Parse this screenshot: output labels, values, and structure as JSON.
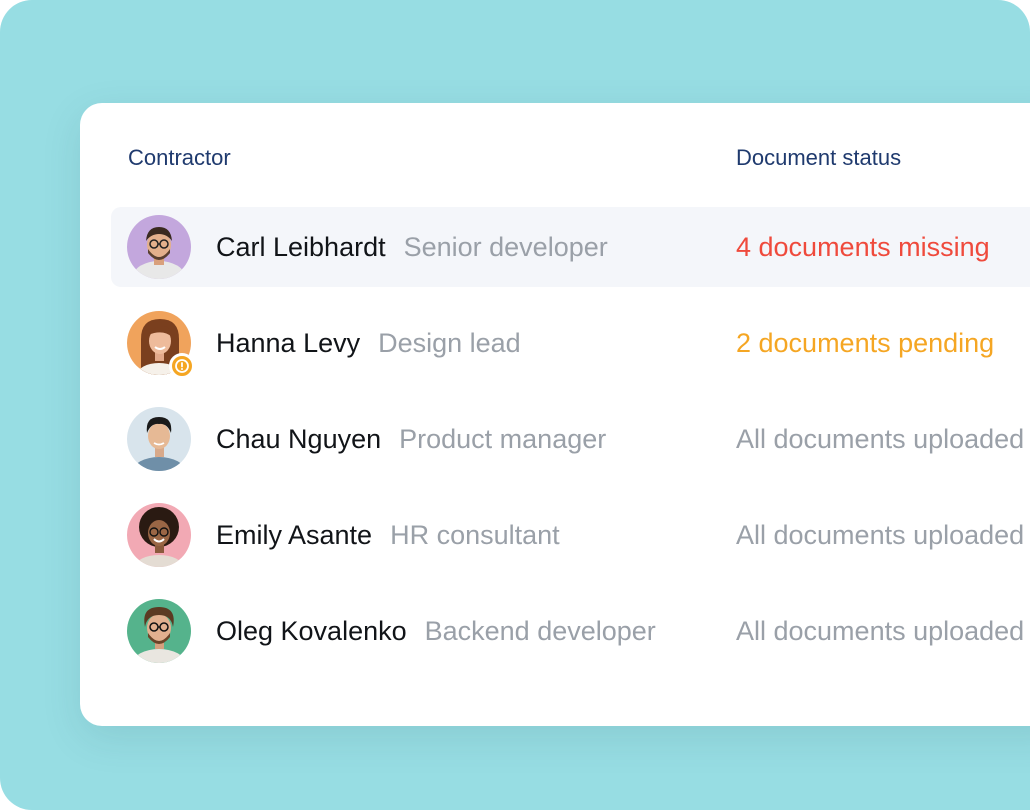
{
  "table": {
    "headers": {
      "contractor": "Contractor",
      "status": "Document status"
    },
    "rows": [
      {
        "name": "Carl Leibhardt",
        "role": "Senior developer",
        "status": "4 documents missing",
        "status_kind": "missing"
      },
      {
        "name": "Hanna Levy",
        "role": "Design lead",
        "status": "2 documents pending",
        "status_kind": "pending"
      },
      {
        "name": "Chau Nguyen",
        "role": "Product manager",
        "status": "All documents uploaded",
        "status_kind": "ok"
      },
      {
        "name": "Emily Asante",
        "role": "HR consultant",
        "status": "All documents uploaded",
        "status_kind": "ok"
      },
      {
        "name": "Oleg Kovalenko",
        "role": "Backend developer",
        "status": "All documents uploaded",
        "status_kind": "ok"
      }
    ]
  },
  "colors": {
    "background": "#97dde3",
    "header_text": "#1f3a6e",
    "missing": "#ef4a3c",
    "pending": "#f5a623",
    "muted": "#9aa0a8",
    "row_highlight": "#f4f6fa"
  },
  "icons": {
    "pending_badge": "alert-circle-icon"
  }
}
